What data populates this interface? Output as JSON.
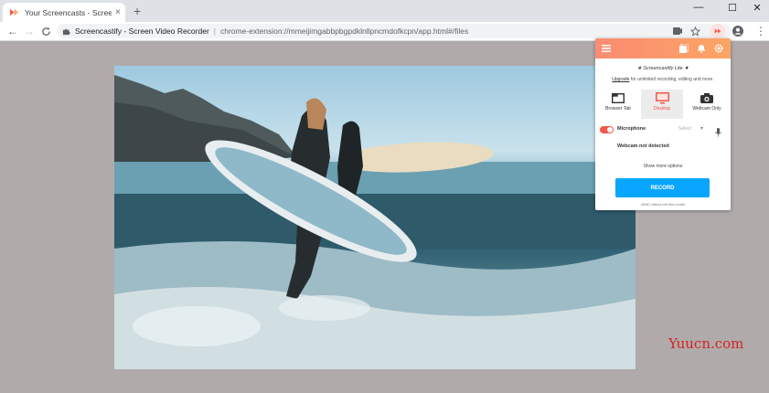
{
  "tab": {
    "title": "Your Screencasts - Screencastify",
    "close": "×"
  },
  "new_tab": "+",
  "window_controls": {
    "minimize": "—",
    "maximize": "☐",
    "close": "✕"
  },
  "toolbar": {
    "back": "←",
    "forward": "→",
    "reload": "C",
    "site_name": "Screencastify - Screen Video Recorder",
    "separator": "|",
    "url": "chrome-extension://mmeijimgabbpbgpdklnllpncmdofkcpn/app.html#/files",
    "menu": "⋮"
  },
  "popup": {
    "lite_title": "★ Screencastify Lite ★",
    "upgrade_link": "Upgrade",
    "upgrade_rest": " for unlimited recording, editing and more.",
    "modes": [
      {
        "label": "Browser Tab",
        "active": false
      },
      {
        "label": "Desktop",
        "active": true
      },
      {
        "label": "Webcam Only",
        "active": false
      }
    ],
    "microphone_label": "Microphone",
    "microphone_select": "Select",
    "microphone_caret": "▾",
    "webcam_status": "Webcam not detected",
    "more_options": "Show more options",
    "record_label": "RECORD",
    "videos_left": "49/50 videos left this month"
  },
  "watermark": "Yuucn.com",
  "colors": {
    "accent": "#f1584a",
    "record": "#08a6ff",
    "header_start": "#fb8c73",
    "header_end": "#fba563"
  }
}
